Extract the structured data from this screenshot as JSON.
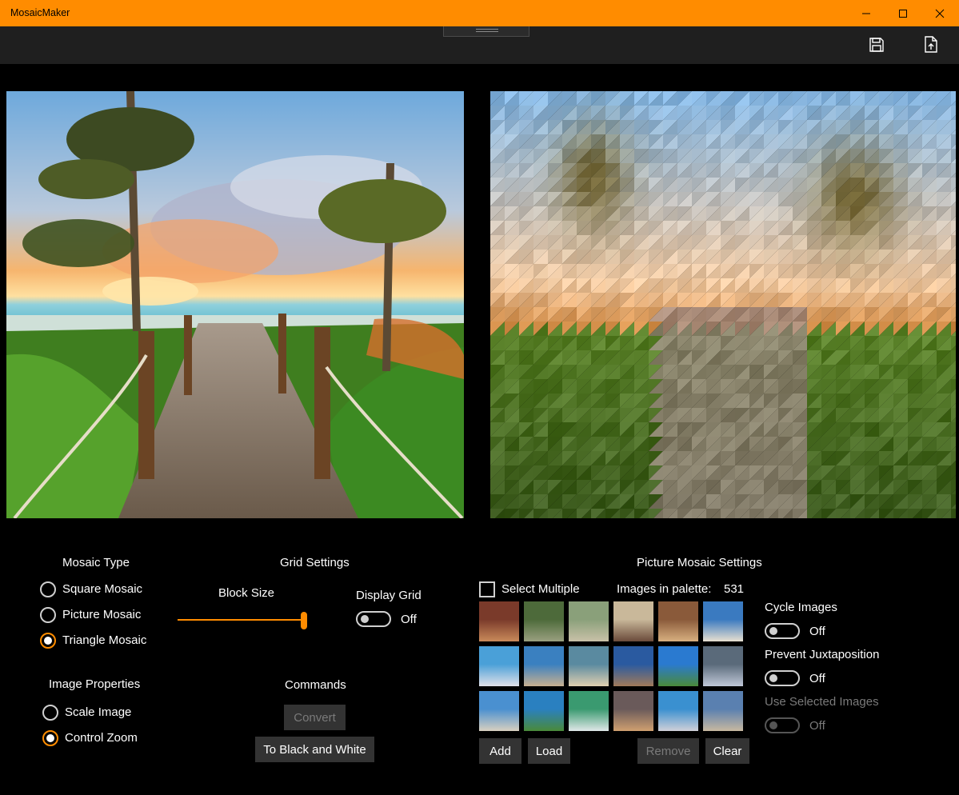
{
  "app": {
    "title": "MosaicMaker",
    "accent": "#FF8C00"
  },
  "window_controls": {
    "minimize_icon": "minimize-icon",
    "maximize_icon": "maximize-icon",
    "close_icon": "close-icon"
  },
  "toolbar": {
    "save_icon": "save-icon",
    "export_icon": "export-icon"
  },
  "images": {
    "source": "source-image",
    "result": "mosaic-result-image"
  },
  "mosaic_type": {
    "heading": "Mosaic Type",
    "options": [
      "Square Mosaic",
      "Picture Mosaic",
      "Triangle Mosaic"
    ],
    "selected": "Triangle Mosaic"
  },
  "image_properties": {
    "heading": "Image Properties",
    "options": [
      "Scale Image",
      "Control Zoom"
    ],
    "selected": "Control Zoom"
  },
  "grid_settings": {
    "heading": "Grid Settings",
    "block_size_label": "Block Size",
    "block_size_level": 1.0,
    "display_grid_label": "Display Grid",
    "display_grid_state": "Off"
  },
  "commands": {
    "heading": "Commands",
    "convert": "Convert",
    "to_bw": "To Black and White"
  },
  "picture_mosaic": {
    "heading": "Picture Mosaic Settings",
    "select_multiple": "Select Multiple",
    "palette_label": "Images in palette:",
    "palette_count": "531",
    "add": "Add",
    "load": "Load",
    "remove": "Remove",
    "clear": "Clear",
    "cycle_images_label": "Cycle Images",
    "cycle_images_state": "Off",
    "prevent_juxtaposition_label": "Prevent Juxtaposition",
    "prevent_juxtaposition_state": "Off",
    "use_selected_label": "Use Selected Images",
    "use_selected_state": "Off"
  }
}
